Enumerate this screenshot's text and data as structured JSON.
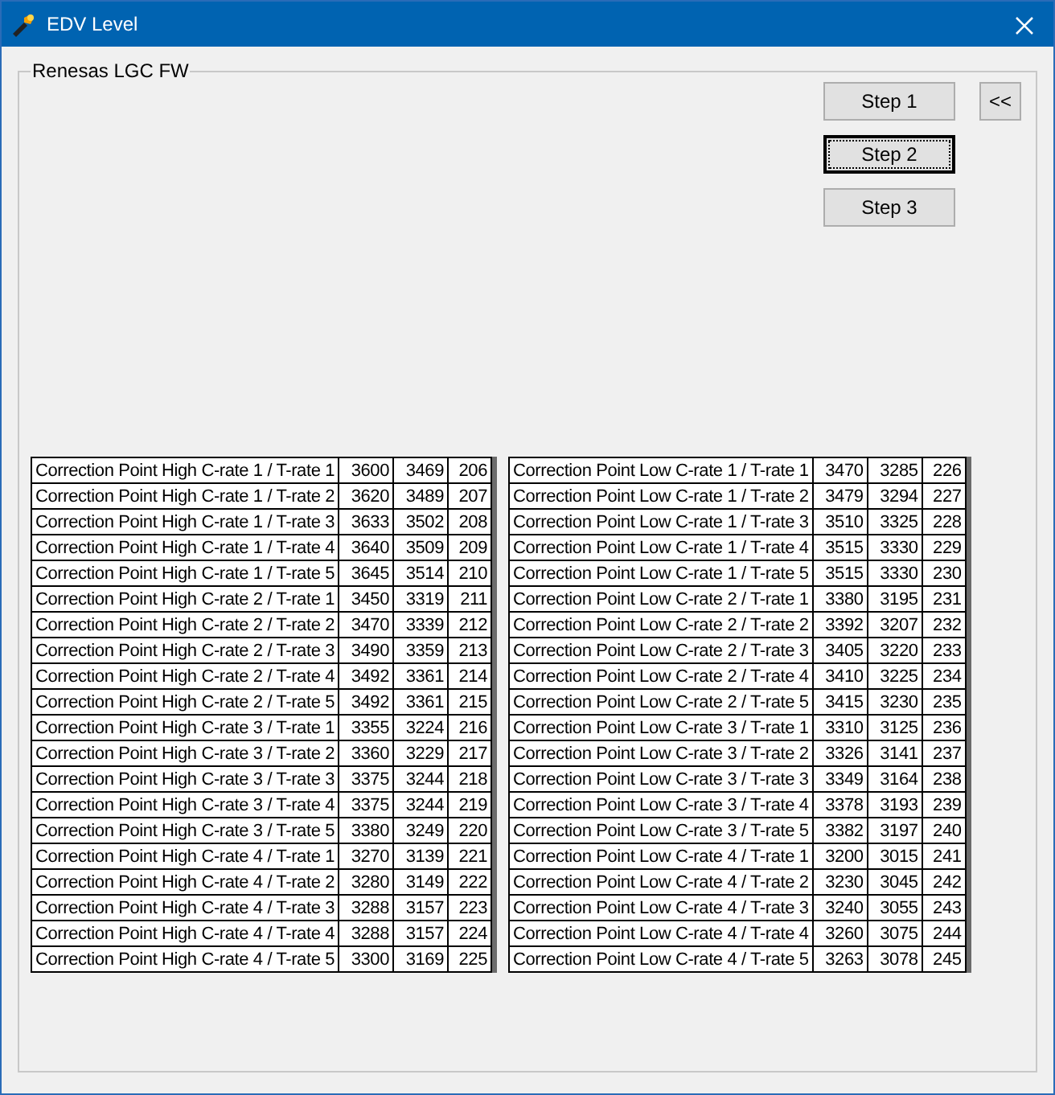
{
  "window": {
    "title": "EDV Level"
  },
  "group": {
    "title": "Renesas LGC FW"
  },
  "step_buttons": [
    {
      "label": "Step 1",
      "focused": false
    },
    {
      "label": "Step 2",
      "focused": true
    },
    {
      "label": "Step 3",
      "focused": false
    }
  ],
  "collapse_button": {
    "label": "<<"
  },
  "tables": [
    {
      "rows": [
        {
          "label": "Correction Point High C-rate 1 / T-rate 1",
          "values": [
            "3600",
            "3469",
            "206"
          ]
        },
        {
          "label": "Correction Point High C-rate 1 / T-rate 2",
          "values": [
            "3620",
            "3489",
            "207"
          ]
        },
        {
          "label": "Correction Point High C-rate 1 / T-rate 3",
          "values": [
            "3633",
            "3502",
            "208"
          ]
        },
        {
          "label": "Correction Point High C-rate 1 / T-rate 4",
          "values": [
            "3640",
            "3509",
            "209"
          ]
        },
        {
          "label": "Correction Point High C-rate 1 / T-rate 5",
          "values": [
            "3645",
            "3514",
            "210"
          ]
        },
        {
          "label": "Correction Point High C-rate 2 / T-rate 1",
          "values": [
            "3450",
            "3319",
            "211"
          ]
        },
        {
          "label": "Correction Point High C-rate 2 / T-rate 2",
          "values": [
            "3470",
            "3339",
            "212"
          ]
        },
        {
          "label": "Correction Point High C-rate 2 / T-rate 3",
          "values": [
            "3490",
            "3359",
            "213"
          ]
        },
        {
          "label": "Correction Point High C-rate 2 / T-rate 4",
          "values": [
            "3492",
            "3361",
            "214"
          ]
        },
        {
          "label": "Correction Point High C-rate 2 / T-rate 5",
          "values": [
            "3492",
            "3361",
            "215"
          ]
        },
        {
          "label": "Correction Point High C-rate 3 / T-rate 1",
          "values": [
            "3355",
            "3224",
            "216"
          ]
        },
        {
          "label": "Correction Point High C-rate 3 / T-rate 2",
          "values": [
            "3360",
            "3229",
            "217"
          ]
        },
        {
          "label": "Correction Point High C-rate 3 / T-rate 3",
          "values": [
            "3375",
            "3244",
            "218"
          ]
        },
        {
          "label": "Correction Point High C-rate 3 / T-rate 4",
          "values": [
            "3375",
            "3244",
            "219"
          ]
        },
        {
          "label": "Correction Point High C-rate 3 / T-rate 5",
          "values": [
            "3380",
            "3249",
            "220"
          ]
        },
        {
          "label": "Correction Point High C-rate 4 / T-rate 1",
          "values": [
            "3270",
            "3139",
            "221"
          ]
        },
        {
          "label": "Correction Point High C-rate 4 / T-rate 2",
          "values": [
            "3280",
            "3149",
            "222"
          ]
        },
        {
          "label": "Correction Point High C-rate 4 / T-rate 3",
          "values": [
            "3288",
            "3157",
            "223"
          ]
        },
        {
          "label": "Correction Point High C-rate 4 / T-rate 4",
          "values": [
            "3288",
            "3157",
            "224"
          ]
        },
        {
          "label": "Correction Point High C-rate 4 / T-rate 5",
          "values": [
            "3300",
            "3169",
            "225"
          ]
        }
      ]
    },
    {
      "rows": [
        {
          "label": "Correction Point Low C-rate 1 / T-rate 1",
          "values": [
            "3470",
            "3285",
            "226"
          ]
        },
        {
          "label": "Correction Point Low C-rate 1 / T-rate 2",
          "values": [
            "3479",
            "3294",
            "227"
          ]
        },
        {
          "label": "Correction Point Low C-rate 1 / T-rate 3",
          "values": [
            "3510",
            "3325",
            "228"
          ]
        },
        {
          "label": "Correction Point Low C-rate 1 / T-rate 4",
          "values": [
            "3515",
            "3330",
            "229"
          ]
        },
        {
          "label": "Correction Point Low C-rate 1 / T-rate 5",
          "values": [
            "3515",
            "3330",
            "230"
          ]
        },
        {
          "label": "Correction Point Low C-rate 2 / T-rate 1",
          "values": [
            "3380",
            "3195",
            "231"
          ]
        },
        {
          "label": "Correction Point Low C-rate 2 / T-rate 2",
          "values": [
            "3392",
            "3207",
            "232"
          ]
        },
        {
          "label": "Correction Point Low C-rate 2 / T-rate 3",
          "values": [
            "3405",
            "3220",
            "233"
          ]
        },
        {
          "label": "Correction Point Low C-rate 2 / T-rate 4",
          "values": [
            "3410",
            "3225",
            "234"
          ]
        },
        {
          "label": "Correction Point Low C-rate 2 / T-rate 5",
          "values": [
            "3415",
            "3230",
            "235"
          ]
        },
        {
          "label": "Correction Point Low C-rate 3 / T-rate 1",
          "values": [
            "3310",
            "3125",
            "236"
          ]
        },
        {
          "label": "Correction Point Low C-rate 3 / T-rate 2",
          "values": [
            "3326",
            "3141",
            "237"
          ]
        },
        {
          "label": "Correction Point Low C-rate 3 / T-rate 3",
          "values": [
            "3349",
            "3164",
            "238"
          ]
        },
        {
          "label": "Correction Point Low C-rate 3 / T-rate 4",
          "values": [
            "3378",
            "3193",
            "239"
          ]
        },
        {
          "label": "Correction Point Low C-rate 3 / T-rate 5",
          "values": [
            "3382",
            "3197",
            "240"
          ]
        },
        {
          "label": "Correction Point Low C-rate 4 / T-rate 1",
          "values": [
            "3200",
            "3015",
            "241"
          ]
        },
        {
          "label": "Correction Point Low C-rate 4 / T-rate 2",
          "values": [
            "3230",
            "3045",
            "242"
          ]
        },
        {
          "label": "Correction Point Low C-rate 4 / T-rate 3",
          "values": [
            "3240",
            "3055",
            "243"
          ]
        },
        {
          "label": "Correction Point Low C-rate 4 / T-rate 4",
          "values": [
            "3260",
            "3075",
            "244"
          ]
        },
        {
          "label": "Correction Point Low C-rate 4 / T-rate 5",
          "values": [
            "3263",
            "3078",
            "245"
          ]
        }
      ]
    }
  ]
}
